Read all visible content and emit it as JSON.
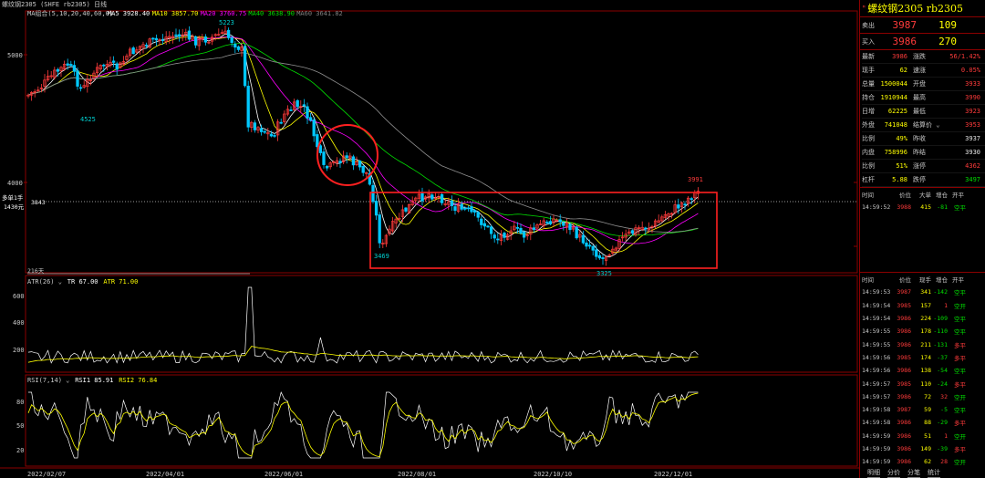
{
  "header": {
    "title_small": "螺纹钢2305 (SHFE rb2305) 日线",
    "ma_legend": [
      {
        "label": "MA组合(5,10,20,40,60,0)",
        "color": "#c8c8c8"
      },
      {
        "label": "MA5 3928.40",
        "color": "#ffffff"
      },
      {
        "label": "MA10 3857.70",
        "color": "#ffff00"
      },
      {
        "label": "MA20 3760.75",
        "color": "#ff00ff"
      },
      {
        "label": "MA40 3638.90",
        "color": "#00e000"
      },
      {
        "label": "MA60 3641.82",
        "color": "#808080"
      }
    ]
  },
  "main_axis": {
    "labels": [
      "5000",
      "4000"
    ]
  },
  "price_annotations": {
    "high": "5223",
    "low_left": "4525",
    "low_mid": "3469",
    "low_right": "3325",
    "recent_high": "3991",
    "lot_label": "多单1手",
    "lot_value": "1430元",
    "ref_price": "3843",
    "bars_label": "216天"
  },
  "atr": {
    "legend": [
      {
        "label": "ATR(26) ⌄",
        "color": "#c8c8c8"
      },
      {
        "label": "TR 67.00",
        "color": "#ffffff"
      },
      {
        "label": "ATR 71.00",
        "color": "#ffff00"
      }
    ],
    "axis": [
      "600",
      "400",
      "200"
    ]
  },
  "rsi": {
    "legend": [
      {
        "label": "RSI(7,14) ⌄",
        "color": "#c8c8c8"
      },
      {
        "label": "RSI1 85.91",
        "color": "#ffffff"
      },
      {
        "label": "RSI2 76.84",
        "color": "#ffff00"
      }
    ],
    "axis": [
      "80",
      "50",
      "20"
    ]
  },
  "x_axis": [
    "2022/02/07",
    "2022/04/01",
    "2022/06/01",
    "2022/08/01",
    "2022/10/10",
    "2022/12/01"
  ],
  "quote": {
    "name": "螺纹钢2305 rb2305",
    "sell": {
      "label": "卖出",
      "price": "3987",
      "vol": "109"
    },
    "buy": {
      "label": "买入",
      "price": "3986",
      "vol": "270"
    },
    "rows": [
      {
        "l1": "最新",
        "v1": "3986",
        "c1": "red",
        "l2": "涨跌",
        "v2": "56/1.42%",
        "c2": "red"
      },
      {
        "l1": "现手",
        "v1": "62",
        "c1": "yel",
        "l2": "速涨",
        "v2": "0.05%",
        "c2": "red"
      },
      {
        "l1": "总量",
        "v1": "1500044",
        "c1": "yel",
        "l2": "开盘",
        "v2": "3933",
        "c2": "red"
      },
      {
        "l1": "持仓",
        "v1": "1910944",
        "c1": "yel",
        "l2": "最高",
        "v2": "3990",
        "c2": "red"
      },
      {
        "l1": "日增",
        "v1": "62225",
        "c1": "yel",
        "l2": "最低",
        "v2": "3923",
        "c2": "red"
      },
      {
        "l1": "外盘",
        "v1": "741048",
        "c1": "yel",
        "l2": "结算价 ⌄",
        "v2": "3953",
        "c2": "red"
      },
      {
        "l1": "比例",
        "v1": "49%",
        "c1": "yel",
        "l2": "昨收",
        "v2": "3937",
        "c2": "white"
      },
      {
        "l1": "内盘",
        "v1": "758996",
        "c1": "yel",
        "l2": "昨结",
        "v2": "3930",
        "c2": "white"
      },
      {
        "l1": "比例",
        "v1": "51%",
        "c1": "yel",
        "l2": "涨停",
        "v2": "4362",
        "c2": "red"
      },
      {
        "l1": "杠杆",
        "v1": "5.88",
        "c1": "yel",
        "l2": "跌停",
        "v2": "3497",
        "c2": "green"
      }
    ]
  },
  "ticks_header": [
    "时间",
    "价位",
    "大单",
    "增仓",
    "开平"
  ],
  "ticks_top": [
    {
      "t": "14:59:52",
      "p": "3988",
      "v": "415",
      "d": "-81",
      "k": "空平"
    }
  ],
  "ticks_header2": [
    "时间",
    "价位",
    "现手",
    "增仓",
    "开平"
  ],
  "ticks": [
    {
      "t": "14:59:53",
      "p": "3987",
      "v": "341",
      "d": "-142",
      "k": "空平"
    },
    {
      "t": "14:59:54",
      "p": "3985",
      "v": "157",
      "d": "1",
      "k": "空开"
    },
    {
      "t": "14:59:54",
      "p": "3986",
      "v": "224",
      "d": "-109",
      "k": "空平"
    },
    {
      "t": "14:59:55",
      "p": "3986",
      "v": "178",
      "d": "-110",
      "k": "空平"
    },
    {
      "t": "14:59:55",
      "p": "3986",
      "v": "211",
      "d": "-131",
      "k": "多平"
    },
    {
      "t": "14:59:56",
      "p": "3985",
      "v": "174",
      "d": "-37",
      "k": "多平"
    },
    {
      "t": "14:59:56",
      "p": "3986",
      "v": "138",
      "d": "-54",
      "k": "空平"
    },
    {
      "t": "14:59:57",
      "p": "3985",
      "v": "110",
      "d": "-24",
      "k": "多平"
    },
    {
      "t": "14:59:57",
      "p": "3986",
      "v": "72",
      "d": "32",
      "k": "空开"
    },
    {
      "t": "14:59:58",
      "p": "3987",
      "v": "59",
      "d": "-5",
      "k": "空平"
    },
    {
      "t": "14:59:58",
      "p": "3986",
      "v": "88",
      "d": "-29",
      "k": "多平"
    },
    {
      "t": "14:59:59",
      "p": "3986",
      "v": "51",
      "d": "1",
      "k": "空开"
    },
    {
      "t": "14:59:59",
      "p": "3986",
      "v": "149",
      "d": "-39",
      "k": "多平"
    },
    {
      "t": "14:59:59",
      "p": "3986",
      "v": "62",
      "d": "28",
      "k": "空开"
    }
  ],
  "bottom_tabs": [
    "明细",
    "分价",
    "分笔",
    "统计"
  ]
}
